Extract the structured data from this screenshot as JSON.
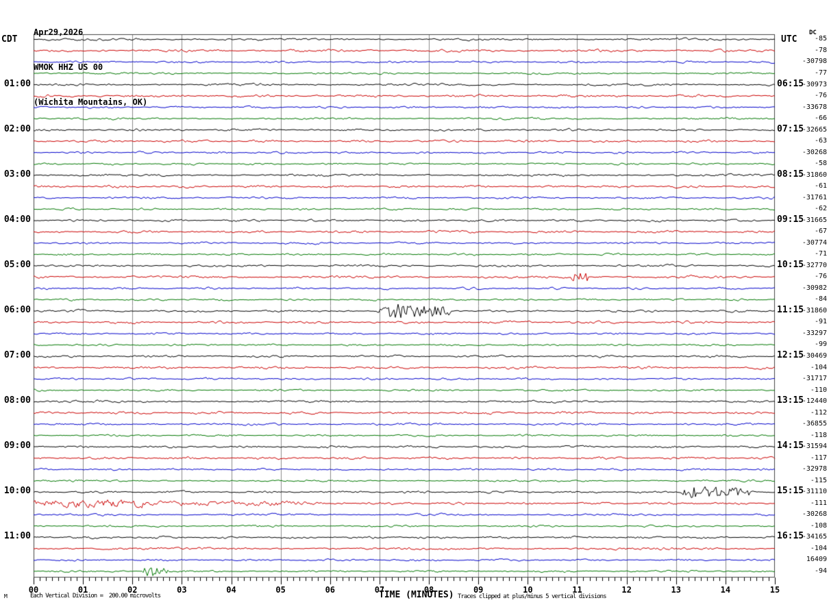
{
  "header": {
    "date_line": "Apr29,2026",
    "station_line": "WMOK HHZ US 00",
    "location_line": "(Wichita Mountains, OK)"
  },
  "axes": {
    "left_label": "CDT",
    "right_label": "UTC",
    "dc_header": "DC",
    "left_hour_labels": [
      "01:00",
      "02:00",
      "03:00",
      "04:00",
      "05:00",
      "06:00",
      "07:00",
      "08:00",
      "09:00",
      "10:00",
      "11:00"
    ],
    "right_hour_labels": [
      "06:15",
      "07:15",
      "08:15",
      "09:15",
      "10:15",
      "11:15",
      "12:15",
      "13:15",
      "14:15",
      "15:15",
      "16:15"
    ],
    "x_tick_labels": [
      "00",
      "01",
      "02",
      "03",
      "04",
      "05",
      "06",
      "07",
      "08",
      "09",
      "10",
      "11",
      "12",
      "13",
      "14",
      "15"
    ],
    "x_axis_label": "TIME (MINUTES)"
  },
  "footer": {
    "corner_mark": "M",
    "scale_note": "Each Vertical Division =  200.00 microvolts",
    "clip_note": "Traces clipped at plus/minus 5 vertical divisions"
  },
  "chart_data": {
    "type": "line",
    "subtype": "helicorder-seismogram",
    "title": "WMOK HHZ US 00 (Wichita Mountains, OK) Apr29,2026",
    "xlabel": "TIME (MINUTES)",
    "x_range_minutes": [
      0,
      15
    ],
    "minutes_per_row": 15,
    "rows_per_hour": 4,
    "n_rows": 48,
    "grid": "vertical-per-minute",
    "trace_color_cycle": [
      "#000000",
      "#cc0000",
      "#0000cc",
      "#007700"
    ],
    "grid_color": "#8a8a8a",
    "hour_label_rows": [
      4,
      8,
      12,
      16,
      20,
      24,
      28,
      32,
      36,
      40,
      44
    ],
    "dc_offsets": [
      -85,
      -78,
      -30798,
      -77,
      -30973,
      -76,
      -33678,
      -66,
      -32665,
      -63,
      -30268,
      -58,
      -31860,
      -61,
      -31761,
      -62,
      -31665,
      -67,
      -30774,
      -71,
      -32770,
      -76,
      -30982,
      -84,
      -31860,
      -91,
      -33297,
      -99,
      -30469,
      -104,
      -31717,
      -110,
      -12440,
      -112,
      -36855,
      -118,
      -31594,
      -117,
      -32978,
      -115,
      -31110,
      -111,
      -30268,
      -108,
      -34165,
      -104,
      16409,
      -94
    ],
    "events": [
      {
        "row": 21,
        "start_min": 10.85,
        "end_min": 11.25,
        "rel_amplitude": 2.2,
        "high_freq": true,
        "taper": true,
        "description": "small high-frequency burst on red trace of 10:15 UTC group"
      },
      {
        "row": 24,
        "start_min": 6.95,
        "end_min": 8.45,
        "rel_amplitude": 3.4,
        "high_freq": true,
        "taper": true,
        "description": "largest burst, black trace at 06:00 CDT / 11:15 UTC, minutes ~7-8.4"
      },
      {
        "row": 40,
        "start_min": 13.1,
        "end_min": 14.5,
        "rel_amplitude": 2.8,
        "high_freq": true,
        "taper": true,
        "description": "burst on black trace at 10:00 CDT / 15:15 UTC, minutes ~13-14.5"
      },
      {
        "row": 41,
        "start_min": 0.0,
        "end_min": 2.3,
        "rel_amplitude": 2.4,
        "high_freq": false,
        "taper": false,
        "description": "elevated long-period noise at start of red trace after 10:00 CDT"
      },
      {
        "row": 41,
        "start_min": 2.3,
        "end_min": 5.6,
        "rel_amplitude": 1.5,
        "high_freq": false,
        "taper": false,
        "description": "decaying elevated noise on same red trace"
      },
      {
        "row": 47,
        "start_min": 2.2,
        "end_min": 2.75,
        "rel_amplitude": 2.6,
        "high_freq": true,
        "taper": true,
        "description": "small burst on last green trace, minute ~2.3"
      }
    ],
    "notes": "48 rows of 15 minutes each; colors cycle black/red/blue/green; traces clipped at plus/minus 5 vertical divisions; each vertical division = 200.00 microvolts"
  }
}
